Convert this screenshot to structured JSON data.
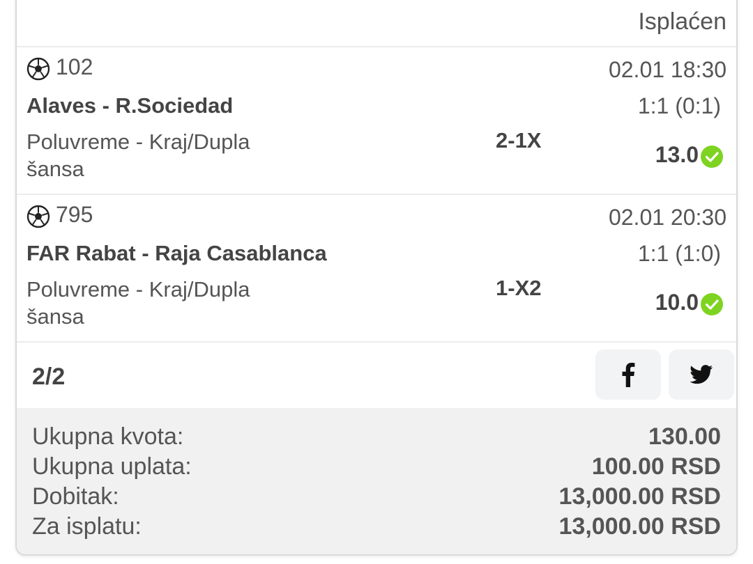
{
  "ticket": {
    "status": "Isplaćen",
    "matches": [
      {
        "sport_icon": "soccer-ball-icon",
        "code": "102",
        "datetime": "02.01 18:30",
        "teams": "Alaves - R.Sociedad",
        "score": "1:1 (0:1)",
        "market": "Poluvreme - Kraj/Dupla šansa",
        "pick": "2-1X",
        "odd": "13.0",
        "result_icon": "check-circle-icon"
      },
      {
        "sport_icon": "soccer-ball-icon",
        "code": "795",
        "datetime": "02.01 20:30",
        "teams": "FAR Rabat - Raja Casablanca",
        "score": "1:1 (1:0)",
        "market": "Poluvreme - Kraj/Dupla šansa",
        "pick": "1-X2",
        "odd": "10.0",
        "result_icon": "check-circle-icon"
      }
    ],
    "count": "2/2",
    "share": {
      "facebook_icon": "facebook-icon",
      "twitter_icon": "twitter-icon"
    },
    "summary": {
      "total_odds_label": "Ukupna kvota:",
      "total_odds_value": "130.00",
      "stake_label": "Ukupna uplata:",
      "stake_value": "100.00 RSD",
      "win_label": "Dobitak:",
      "win_value": "13,000.00 RSD",
      "payout_label": "Za isplatu:",
      "payout_value": "13,000.00 RSD"
    },
    "colors": {
      "success": "#7ed321",
      "summary_bg": "#f1f1f1",
      "share_bg": "#f2f3f5"
    }
  }
}
